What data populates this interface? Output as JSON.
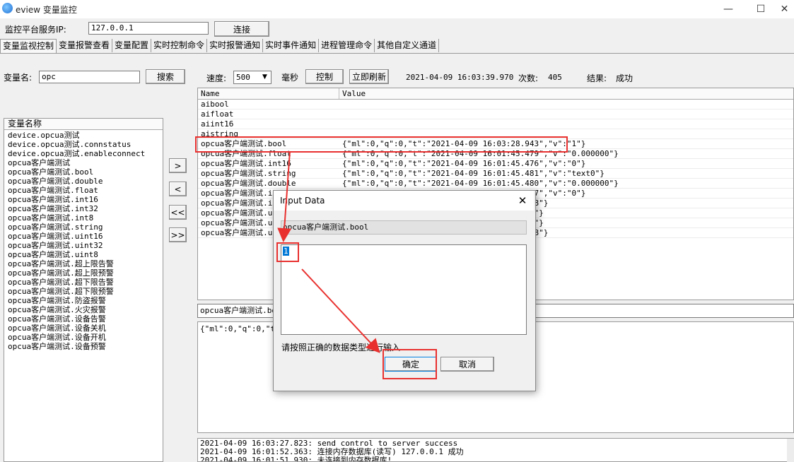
{
  "window": {
    "title": "eview 变量监控",
    "minimize_glyph": "—",
    "maximize_glyph": "☐",
    "close_glyph": "✕"
  },
  "server": {
    "label": "监控平台服务IP:",
    "ip": "127.0.0.1",
    "connect_label": "连接"
  },
  "tabs": [
    {
      "label": "变量监视控制",
      "active": true
    },
    {
      "label": "变量报警查看"
    },
    {
      "label": "变量配置"
    },
    {
      "label": "实时控制命令"
    },
    {
      "label": "实时报警通知"
    },
    {
      "label": "实时事件通知"
    },
    {
      "label": "进程管理命令"
    },
    {
      "label": "其他自定义通道"
    }
  ],
  "search": {
    "label": "变量名:",
    "value": "opc",
    "button": "搜索"
  },
  "toolbar": {
    "speed_label": "速度:",
    "speed_value": "500",
    "unit": "毫秒",
    "control_label": "控制",
    "refresh_label": "立即刷新",
    "timestamp": "2021-04-09 16:03:39.970",
    "count_label": "次数:",
    "count_value": "405",
    "result_label": "结果:",
    "result_value": "成功"
  },
  "varlist": {
    "header": "变量名称",
    "items": [
      "device.opcua测试",
      "device.opcua测试.connstatus",
      "device.opcua测试.enableconnect",
      "opcua客户端测试",
      "opcua客户端测试.bool",
      "opcua客户端测试.double",
      "opcua客户端测试.float",
      "opcua客户端测试.int16",
      "opcua客户端测试.int32",
      "opcua客户端测试.int8",
      "opcua客户端测试.string",
      "opcua客户端测试.uint16",
      "opcua客户端测试.uint32",
      "opcua客户端测试.uint8",
      "opcua客户端测试.超上限告警",
      "opcua客户端测试.超上限预警",
      "opcua客户端测试.超下限告警",
      "opcua客户端测试.超下限预警",
      "opcua客户端测试.防盗报警",
      "opcua客户端测试.火灾报警",
      "opcua客户端测试.设备告警",
      "opcua客户端测试.设备关机",
      "opcua客户端测试.设备开机",
      "opcua客户端测试.设备预警"
    ]
  },
  "move_buttons": [
    ">",
    "<",
    "<<",
    ">>"
  ],
  "grid": {
    "col_name": "Name",
    "col_value": "Value",
    "rows": [
      {
        "name": "aibool",
        "value": ""
      },
      {
        "name": "aifloat",
        "value": ""
      },
      {
        "name": "aiint16",
        "value": ""
      },
      {
        "name": "aistring",
        "value": ""
      },
      {
        "name": "opcua客户端测试.bool",
        "value": "{\"ml\":0,\"q\":0,\"t\":\"2021-04-09 16:03:28.943\",\"v\":\"1\"}"
      },
      {
        "name": "opcua客户端测试.float",
        "value": "{\"ml\":0,\"q\":0,\"t\":\"2021-04-09 16:01:45.479\",\"v\":\"0.000000\"}"
      },
      {
        "name": "opcua客户端测试.int16",
        "value": "{\"ml\":0,\"q\":0,\"t\":\"2021-04-09 16:01:45.476\",\"v\":\"0\"}"
      },
      {
        "name": "opcua客户端测试.string",
        "value": "{\"ml\":0,\"q\":0,\"t\":\"2021-04-09 16:01:45.481\",\"v\":\"text0\"}"
      },
      {
        "name": "opcua客户端测试.double",
        "value": "{\"ml\":0,\"q\":0,\"t\":\"2021-04-09 16:01:45.480\",\"v\":\"0.000000\"}"
      },
      {
        "name": "opcua客户端测试.int32",
        "value": "{\"ml\":0,\"q\":0,\"t\":\"2021-04-09 16:01:45.477\",\"v\":\"0\"}"
      },
      {
        "name": "opcua客户端测试.int8",
        "value": "                                   \"v\":\"48\"}"
      },
      {
        "name": "opcua客户端测试.uint16",
        "value": "                                   \"v\":\"0\"}"
      },
      {
        "name": "opcua客户端测试.uint32",
        "value": "                                   \"v\":\"0\"}"
      },
      {
        "name": "opcua客户端测试.uint8",
        "value": "                                   \"v\":\"48\"}"
      }
    ]
  },
  "selected": {
    "name": "opcua客户端测试.bool",
    "json": "{\"ml\":0,\"q\":0,\"t\":"
  },
  "log": {
    "lines": [
      "2021-04-09 16:03:27.823: send control to server success",
      "2021-04-09 16:01:52.363: 连接内存数据库(读写) 127.0.0.1 成功",
      "2021-04-09 16:01:51.930: 未连接到内存数据库!"
    ]
  },
  "dialog": {
    "title": "Input Data",
    "close_glyph": "✕",
    "var_name": "opcua客户端测试.bool",
    "input_value": "1",
    "hint": "请按照正确的数据类型进行输入",
    "ok_label": "确定",
    "cancel_label": "取消"
  },
  "colors": {
    "annotation": "#e8312f",
    "selection": "#0078d7"
  }
}
